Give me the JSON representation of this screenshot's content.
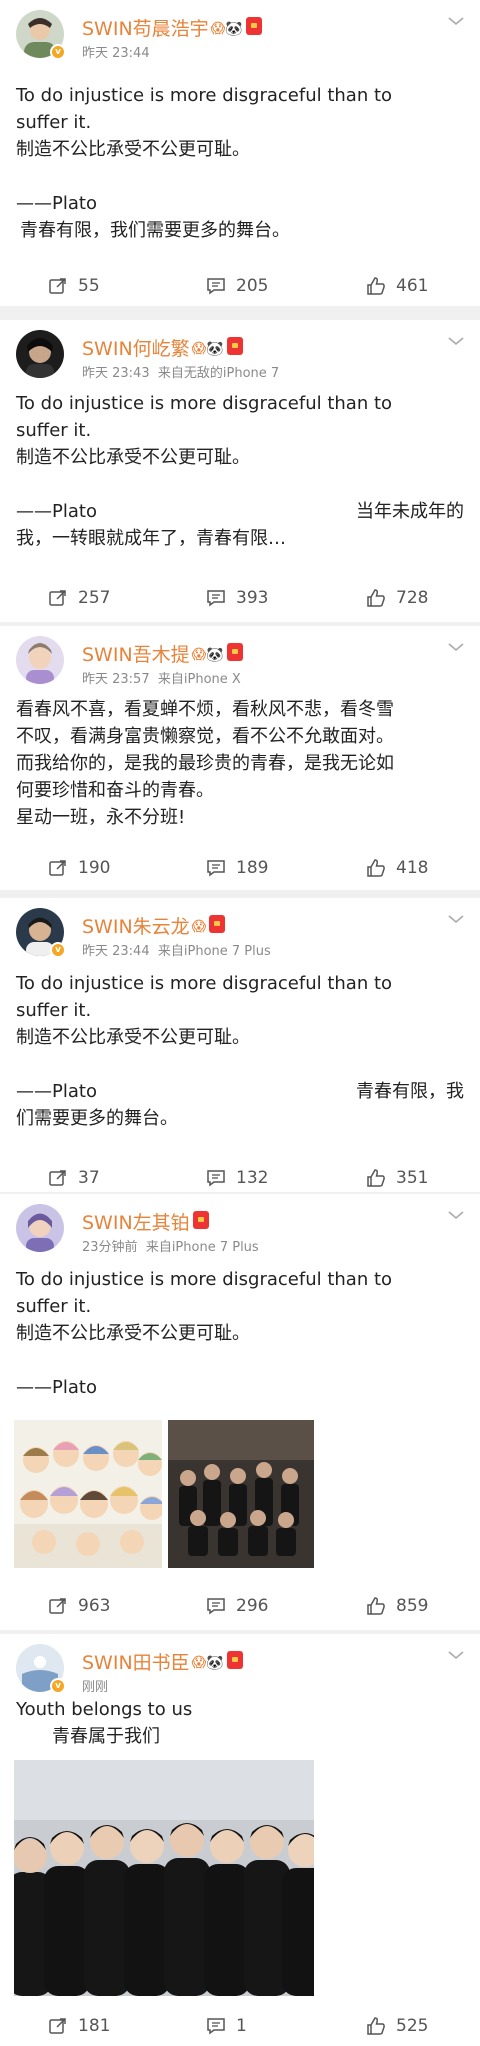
{
  "posts": [
    {
      "username": "SWIN苟晨浩宇",
      "time": "昨天 23:44",
      "source": "",
      "lines": [
        "To do injustice is more disgraceful than to",
        "suffer it.",
        "制造不公比承受不公更可耻。",
        "",
        "——Plato",
        "青春有限，我们需要更多的舞台。"
      ],
      "reposts": "55",
      "comments": "205",
      "likes": "461"
    },
    {
      "username": "SWIN何屹繁",
      "time": "昨天 23:43",
      "source": "来自无敌的iPhone 7",
      "lines": [
        "To do injustice is more disgraceful than to",
        "suffer it.",
        "制造不公比承受不公更可耻。",
        "",
        "——Plato",
        "当年未成年的",
        "我，一转眼就成年了，青春有限…"
      ],
      "reposts": "257",
      "comments": "393",
      "likes": "728"
    },
    {
      "username": "SWIN吾木提",
      "time": "昨天 23:57",
      "source": "来自iPhone X",
      "lines": [
        "看春风不喜，看夏蝉不烦，看秋风不悲，看冬雪",
        "不叹，看满身富贵懒察觉，看不公不允敢面对。",
        "而我给你的，是我的最珍贵的青春，是我无论如",
        "何要珍惜和奋斗的青春。",
        "星动一班，永不分班!"
      ],
      "reposts": "190",
      "comments": "189",
      "likes": "418"
    },
    {
      "username": "SWIN朱云龙",
      "time": "昨天 23:44",
      "source": "来自iPhone 7 Plus",
      "lines": [
        "To do injustice is more disgraceful than to",
        "suffer it.",
        "制造不公比承受不公更可耻。",
        "",
        "——Plato",
        "青春有限，我",
        "们需要更多的舞台。"
      ],
      "reposts": "37",
      "comments": "132",
      "likes": "351"
    },
    {
      "username": "SWIN左其铂",
      "time": "23分钟前",
      "source": "来自iPhone 7 Plus",
      "lines": [
        "To do injustice is more disgraceful than to",
        "suffer it.",
        "制造不公比承受不公更可耻。",
        "",
        "——Plato"
      ],
      "reposts": "963",
      "comments": "296",
      "likes": "859"
    },
    {
      "username": "SWIN田书臣",
      "time": "刚刚",
      "source": "",
      "lines": [
        "Youth belongs to us",
        "青春属于我们"
      ],
      "reposts": "181",
      "comments": "1",
      "likes": "525"
    }
  ],
  "colors": {
    "username": "#e8833a",
    "meta": "#8a8a8a",
    "text": "#222222",
    "separator": "#f0f0f0",
    "vip_badge": "#f5a623",
    "red_badge": "#ee3333"
  },
  "icons": {
    "repost": "repost-icon",
    "comment": "comment-icon",
    "like": "like-icon",
    "menu": "chevron-down-icon"
  }
}
